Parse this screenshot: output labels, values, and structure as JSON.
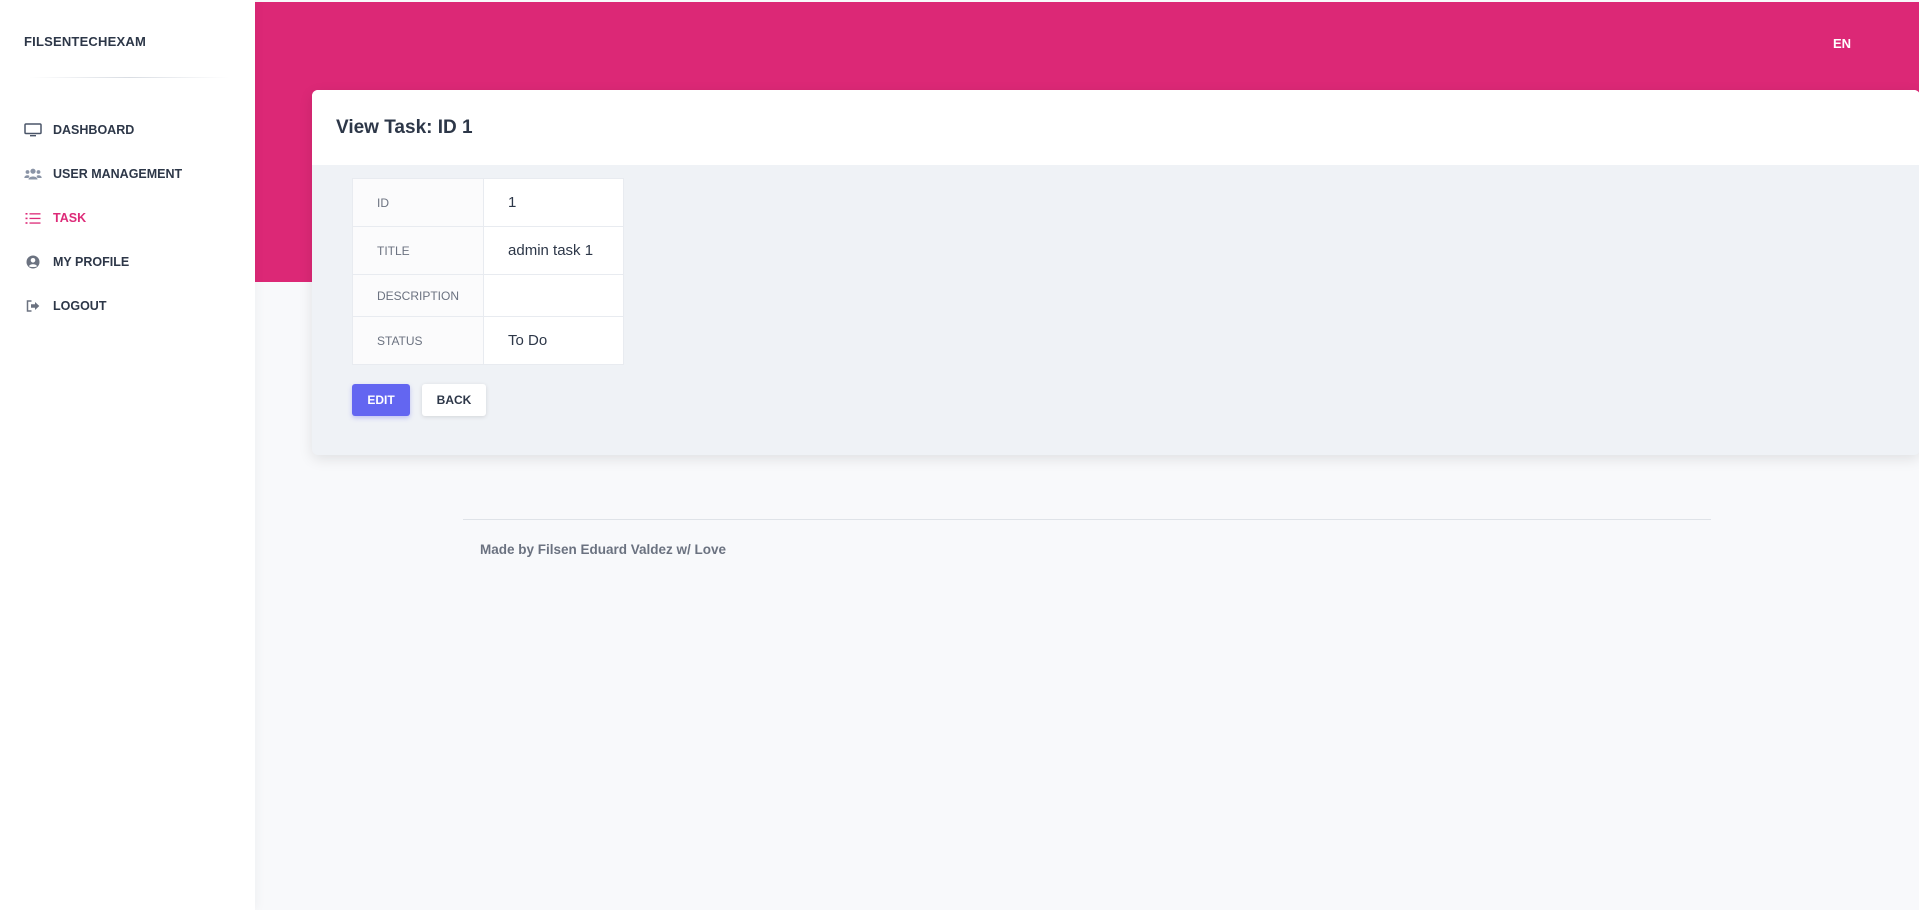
{
  "brand": "FILSENTECHEXAM",
  "nav": [
    {
      "label": "DASHBOARD",
      "icon": "monitor-icon",
      "active": false
    },
    {
      "label": "USER MANAGEMENT",
      "icon": "users-icon",
      "active": false
    },
    {
      "label": "TASK",
      "icon": "tasks-list-icon",
      "active": true
    },
    {
      "label": "MY PROFILE",
      "icon": "user-circle-icon",
      "active": false
    },
    {
      "label": "LOGOUT",
      "icon": "logout-icon",
      "active": false
    }
  ],
  "header": {
    "language": "EN"
  },
  "card": {
    "title": "View Task: ID 1"
  },
  "task": {
    "rows": [
      {
        "key": "ID",
        "value": "1"
      },
      {
        "key": "TITLE",
        "value": "admin task 1"
      },
      {
        "key": "DESCRIPTION",
        "value": ""
      },
      {
        "key": "STATUS",
        "value": "To Do"
      }
    ]
  },
  "buttons": {
    "edit": "EDIT",
    "back": "BACK"
  },
  "footer": {
    "text": "Made by Filsen Eduard Valdez w/ Love"
  },
  "colors": {
    "accent": "#dc2876",
    "primary_button": "#6366f1",
    "text": "#2d3748"
  }
}
